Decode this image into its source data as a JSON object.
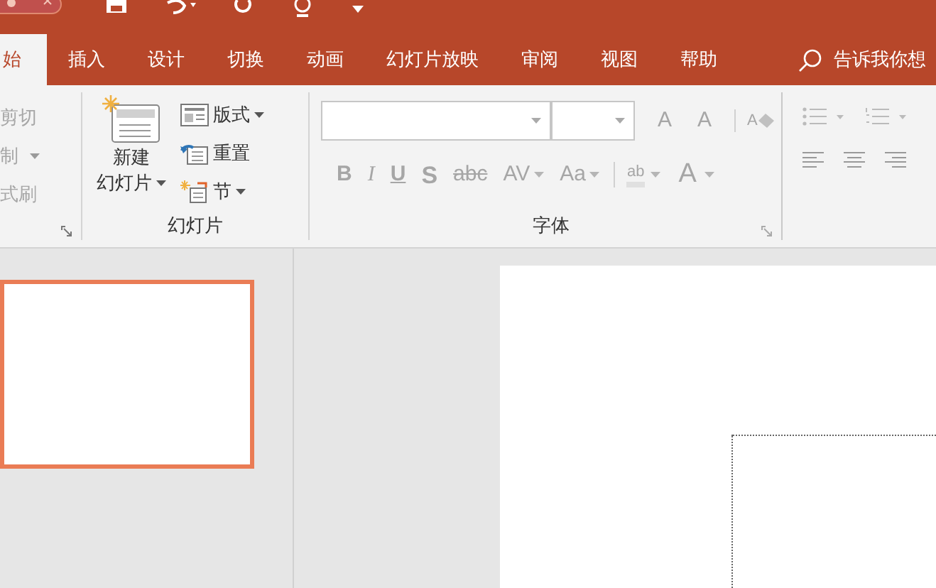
{
  "tabs": [
    {
      "label": "始",
      "selected": true
    },
    {
      "label": "插入",
      "selected": false
    },
    {
      "label": "设计",
      "selected": false
    },
    {
      "label": "切换",
      "selected": false
    },
    {
      "label": "动画",
      "selected": false
    },
    {
      "label": "幻灯片放映",
      "selected": false
    },
    {
      "label": "审阅",
      "selected": false
    },
    {
      "label": "视图",
      "selected": false
    },
    {
      "label": "帮助",
      "selected": false
    }
  ],
  "tell_me": {
    "placeholder": "告诉我你想"
  },
  "clipboard": {
    "items": [
      {
        "label": "剪切",
        "disabled": true
      },
      {
        "label": "制",
        "disabled": true,
        "dropdown": true
      },
      {
        "label": "式刷",
        "disabled": true
      }
    ]
  },
  "slides_group": {
    "label": "幻灯片",
    "new_slide": {
      "lines": [
        "新建",
        "幻灯片"
      ]
    },
    "items": [
      {
        "kind": "layout",
        "label": "版式",
        "dropdown": true
      },
      {
        "kind": "reset",
        "label": "重置",
        "dropdown": false
      },
      {
        "kind": "section",
        "label": "节",
        "dropdown": true
      }
    ]
  },
  "font_group": {
    "label": "字体",
    "buttons": [
      {
        "kind": "bold",
        "glyph": "B"
      },
      {
        "kind": "italic",
        "glyph": "I"
      },
      {
        "kind": "underline",
        "glyph": "U"
      },
      {
        "kind": "shadow",
        "glyph": "S"
      },
      {
        "kind": "strike",
        "glyph": "abc"
      },
      {
        "kind": "spacing",
        "glyph": "AV"
      },
      {
        "kind": "case",
        "glyph": "Aa"
      }
    ],
    "font_color_glyph": "A",
    "grow_glyph": "A",
    "shrink_glyph": "A",
    "clear_glyph": "A",
    "highlight_glyph": "ab"
  },
  "slides_pane": {
    "thumbnail": {
      "selected": true
    }
  }
}
